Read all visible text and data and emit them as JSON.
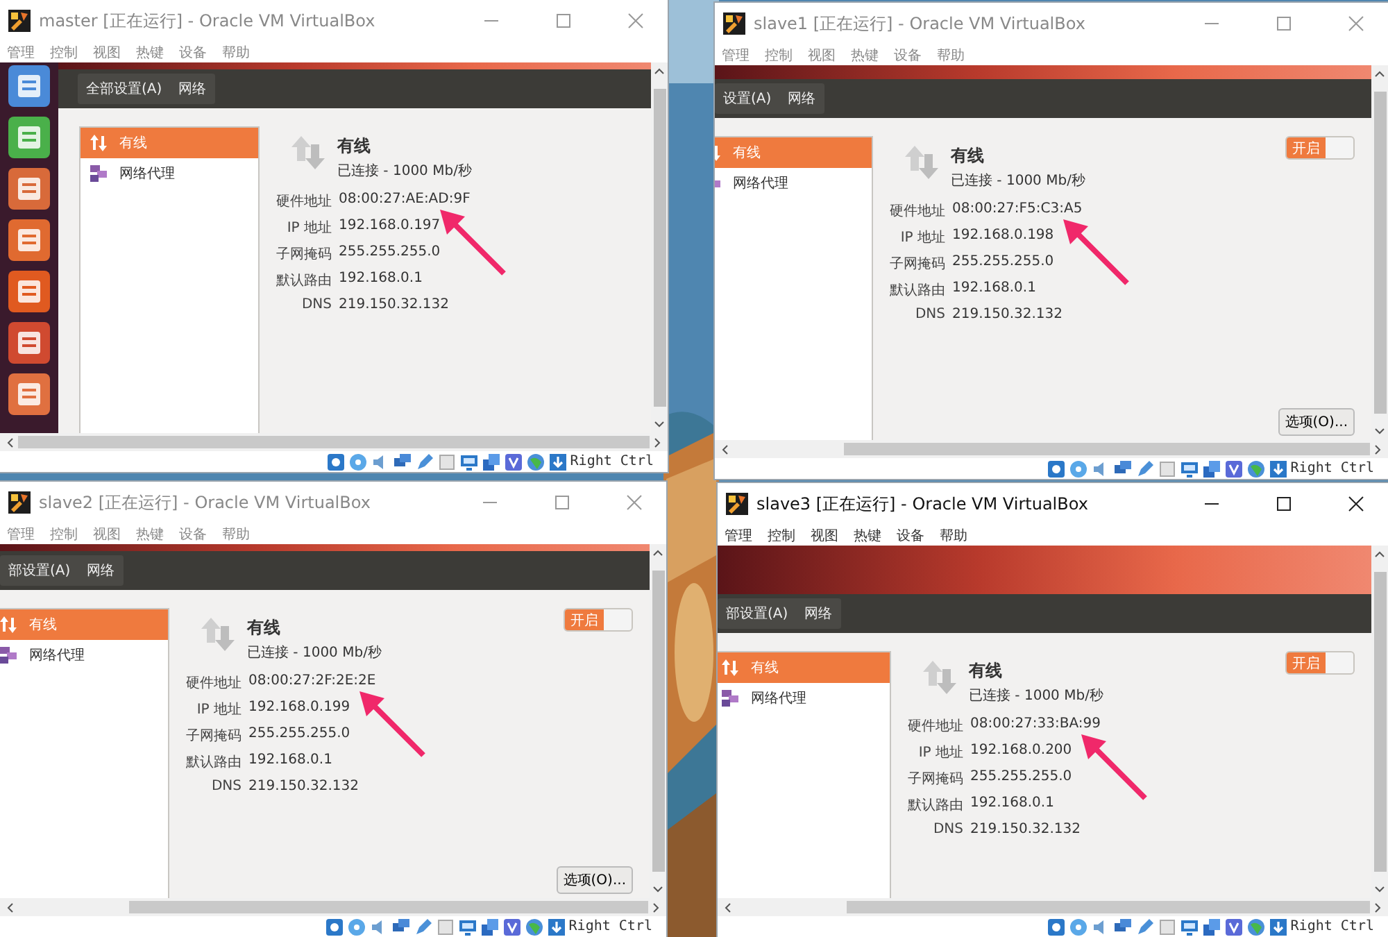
{
  "windows": [
    {
      "title": "master [正在运行] - Oracle VM VirtualBox",
      "active": false,
      "launcher": true,
      "menu": [
        "管理",
        "控制",
        "视图",
        "热键",
        "设备",
        "帮助"
      ],
      "breadcrumb": [
        "全部设置(A)",
        "网络"
      ],
      "sidebar": [
        {
          "label": "有线",
          "selected": true
        },
        {
          "label": "网络代理",
          "selected": false
        }
      ],
      "connection": {
        "name": "有线",
        "status": "已连接 - 1000 Mb/秒"
      },
      "details": [
        {
          "label": "硬件地址",
          "value": "08:00:27:AE:AD:9F"
        },
        {
          "label": "IP 地址",
          "value": "192.168.0.197"
        },
        {
          "label": "子网掩码",
          "value": "255.255.255.0"
        },
        {
          "label": "默认路由",
          "value": "192.168.0.1"
        },
        {
          "label": "DNS",
          "value": "219.150.32.132"
        }
      ],
      "host_key": "Right Ctrl"
    },
    {
      "title": "slave1 [正在运行] - Oracle VM VirtualBox",
      "active": false,
      "launcher": false,
      "menu": [
        "管理",
        "控制",
        "视图",
        "热键",
        "设备",
        "帮助"
      ],
      "breadcrumb": [
        "设置(A)",
        "网络"
      ],
      "sidebar": [
        {
          "label": "有线",
          "selected": true
        },
        {
          "label": "网络代理",
          "selected": false
        }
      ],
      "connection": {
        "name": "有线",
        "status": "已连接 - 1000 Mb/秒"
      },
      "switch": {
        "label": "开启",
        "on": true
      },
      "details": [
        {
          "label": "硬件地址",
          "value": "08:00:27:F5:C3:A5"
        },
        {
          "label": "IP 地址",
          "value": "192.168.0.198"
        },
        {
          "label": "子网掩码",
          "value": "255.255.255.0"
        },
        {
          "label": "默认路由",
          "value": "192.168.0.1"
        },
        {
          "label": "DNS",
          "value": "219.150.32.132"
        }
      ],
      "options_button": "选项(O)...",
      "host_key": "Right Ctrl"
    },
    {
      "title": "slave2 [正在运行] - Oracle VM VirtualBox",
      "active": false,
      "launcher": false,
      "menu": [
        "管理",
        "控制",
        "视图",
        "热键",
        "设备",
        "帮助"
      ],
      "breadcrumb": [
        "部设置(A)",
        "网络"
      ],
      "sidebar": [
        {
          "label": "有线",
          "selected": true
        },
        {
          "label": "网络代理",
          "selected": false
        }
      ],
      "connection": {
        "name": "有线",
        "status": "已连接 - 1000 Mb/秒"
      },
      "switch": {
        "label": "开启",
        "on": true
      },
      "details": [
        {
          "label": "硬件地址",
          "value": "08:00:27:2F:2E:2E"
        },
        {
          "label": "IP 地址",
          "value": "192.168.0.199"
        },
        {
          "label": "子网掩码",
          "value": "255.255.255.0"
        },
        {
          "label": "默认路由",
          "value": "192.168.0.1"
        },
        {
          "label": "DNS",
          "value": "219.150.32.132"
        }
      ],
      "options_button": "选项(O)...",
      "host_key": "Right Ctrl"
    },
    {
      "title": "slave3 [正在运行] - Oracle VM VirtualBox",
      "active": true,
      "launcher": false,
      "menu": [
        "管理",
        "控制",
        "视图",
        "热键",
        "设备",
        "帮助"
      ],
      "breadcrumb": [
        "部设置(A)",
        "网络"
      ],
      "sidebar": [
        {
          "label": "有线",
          "selected": true
        },
        {
          "label": "网络代理",
          "selected": false
        }
      ],
      "connection": {
        "name": "有线",
        "status": "已连接 - 1000 Mb/秒"
      },
      "switch": {
        "label": "开启",
        "on": true
      },
      "details": [
        {
          "label": "硬件地址",
          "value": "08:00:27:33:BA:99"
        },
        {
          "label": "IP 地址",
          "value": "192.168.0.200"
        },
        {
          "label": "子网掩码",
          "value": "255.255.255.0"
        },
        {
          "label": "默认路由",
          "value": "192.168.0.1"
        },
        {
          "label": "DNS",
          "value": "219.150.32.132"
        }
      ],
      "host_key": "Right Ctrl"
    }
  ]
}
